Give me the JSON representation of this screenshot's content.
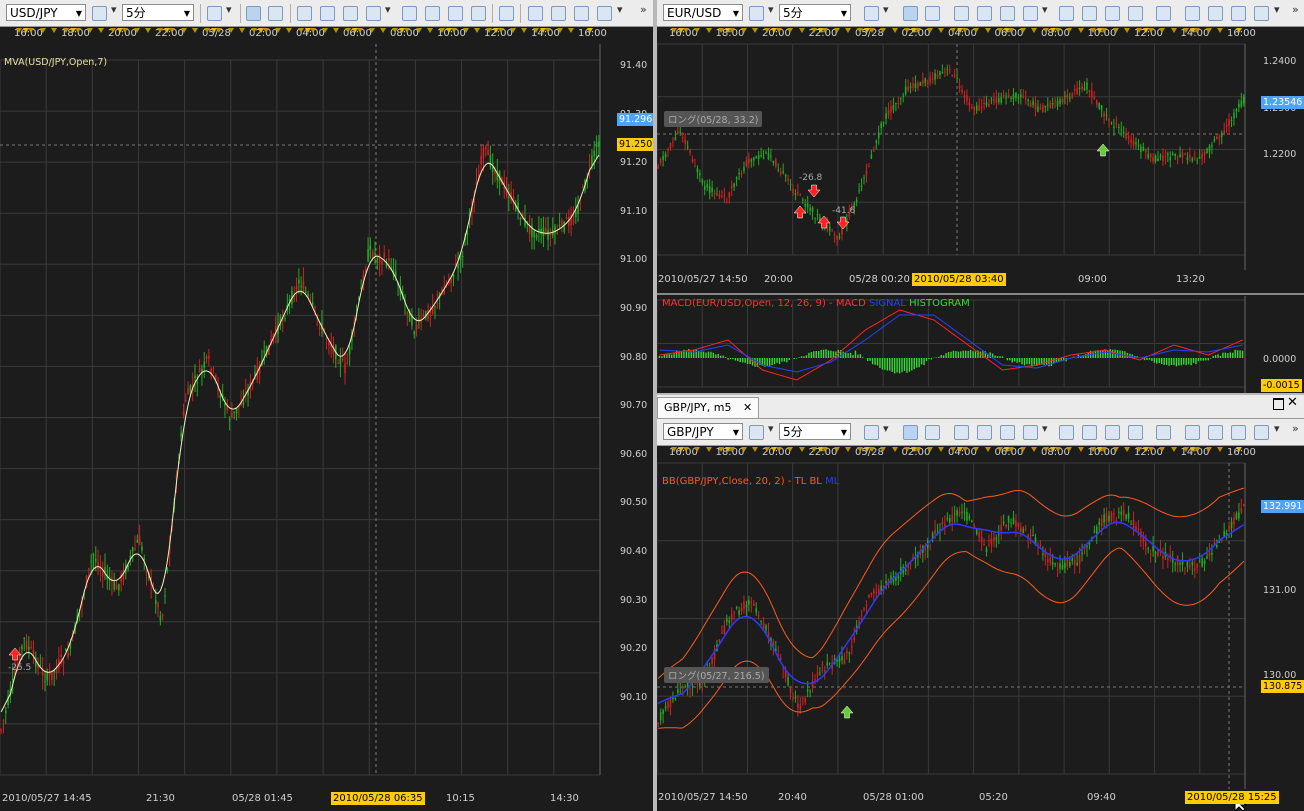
{
  "colors": {
    "bg": "#1c1c1c",
    "up": "#22aa22",
    "down": "#cc2222",
    "grid": "#3a3a3a",
    "ma": "#f0f0c0",
    "bb": "#ff5a1a",
    "bb_mid": "#2a3aff",
    "macd": "#ff2222",
    "signal": "#2244ff",
    "hist": "#33dd33"
  },
  "left": {
    "symbol": "USD/JPY",
    "period": "5分",
    "time_labels": [
      "16:00",
      "18:00",
      "20:00",
      "22:00",
      "05/28",
      "02:00",
      "04:00",
      "06:00",
      "08:00",
      "10:00",
      "12:00",
      "14:00",
      "16:00"
    ],
    "indicator": "MVA(USD/JPY,Open,7)",
    "price_labels": [
      "91.40",
      "91.30",
      "91.20",
      "91.10",
      "91.00",
      "90.90",
      "90.80",
      "90.70",
      "90.60",
      "90.50",
      "90.40",
      "90.30",
      "90.20",
      "90.10"
    ],
    "current_price": "91.296",
    "cursor_price": "91.250",
    "x_labels": [
      "2010/05/27 14:45",
      "21:30",
      "05/28 01:45",
      "10:15",
      "14:30"
    ],
    "cursor_time": "2010/05/28 06:35",
    "marker_label": "-25.5"
  },
  "eurusd": {
    "symbol": "EUR/USD",
    "period": "5分",
    "time_labels": [
      "16:00",
      "18:00",
      "20:00",
      "22:00",
      "05/28",
      "02:00",
      "04:00",
      "06:00",
      "08:00",
      "10:00",
      "12:00",
      "14:00",
      "16:00"
    ],
    "price_labels": [
      "1.2400",
      "1.2300",
      "1.2200"
    ],
    "current_price": "1.23546",
    "tag": "ロング(05/28, 33.2)",
    "marker_labels": [
      "-26.8",
      "-41.6"
    ],
    "x_labels": [
      "2010/05/27 14:50",
      "20:00",
      "05/28 00:20",
      "09:00",
      "13:20"
    ],
    "cursor_time": "2010/05/28 03:40",
    "macd_label": "MACD(EUR/USD,Open, 12, 26, 9) -  MACD",
    "macd_signal": "SIGNAL",
    "macd_hist": "HISTOGRAM",
    "macd_zero": "0.0000",
    "macd_cur": "-0.0015"
  },
  "gbpjpy": {
    "tab_title": "GBP/JPY, m5",
    "symbol": "GBP/JPY",
    "period": "5分",
    "time_labels": [
      "16:00",
      "18:00",
      "20:00",
      "22:00",
      "05/28",
      "02:00",
      "04:00",
      "06:00",
      "08:00",
      "10:00",
      "12:00",
      "14:00",
      "16:00"
    ],
    "indicator": "BB(GBP/JPY,Close, 20, 2) -  TL  BL",
    "indicator_ml": "ML",
    "price_labels": [
      "132.00",
      "131.00",
      "130.00"
    ],
    "current_price": "132.991",
    "cursor_price": "130.875",
    "tag": "ロング(05/27, 216.5)",
    "x_labels": [
      "2010/05/27 14:50",
      "20:40",
      "05/28 01:00",
      "05:20",
      "09:40"
    ],
    "cursor_time": "2010/05/28 15:25"
  }
}
